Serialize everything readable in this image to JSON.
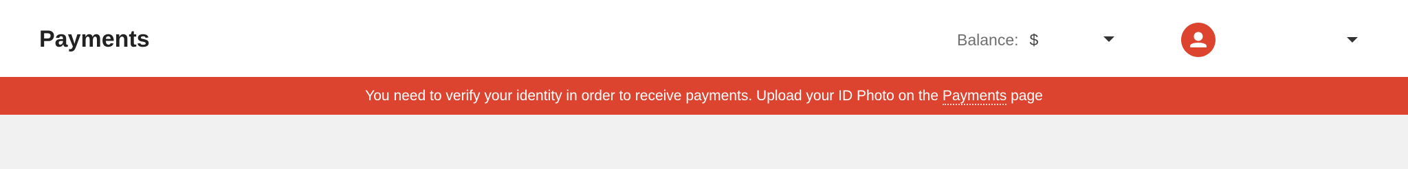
{
  "header": {
    "title": "Payments",
    "balance_label": "Balance:",
    "balance_value": "$",
    "balance_dropdown_icon": "caret-down-icon",
    "avatar_icon": "user-icon",
    "user_menu_icon": "caret-down-icon"
  },
  "alert": {
    "text_before": "You need to verify your identity in order to receive payments. Upload your ID Photo on the ",
    "link_text": "Payments",
    "text_after": " page"
  },
  "colors": {
    "accent": "#dc4430",
    "header_bg": "#ffffff",
    "content_bg": "#f1f1f1",
    "title_text": "#222222"
  }
}
